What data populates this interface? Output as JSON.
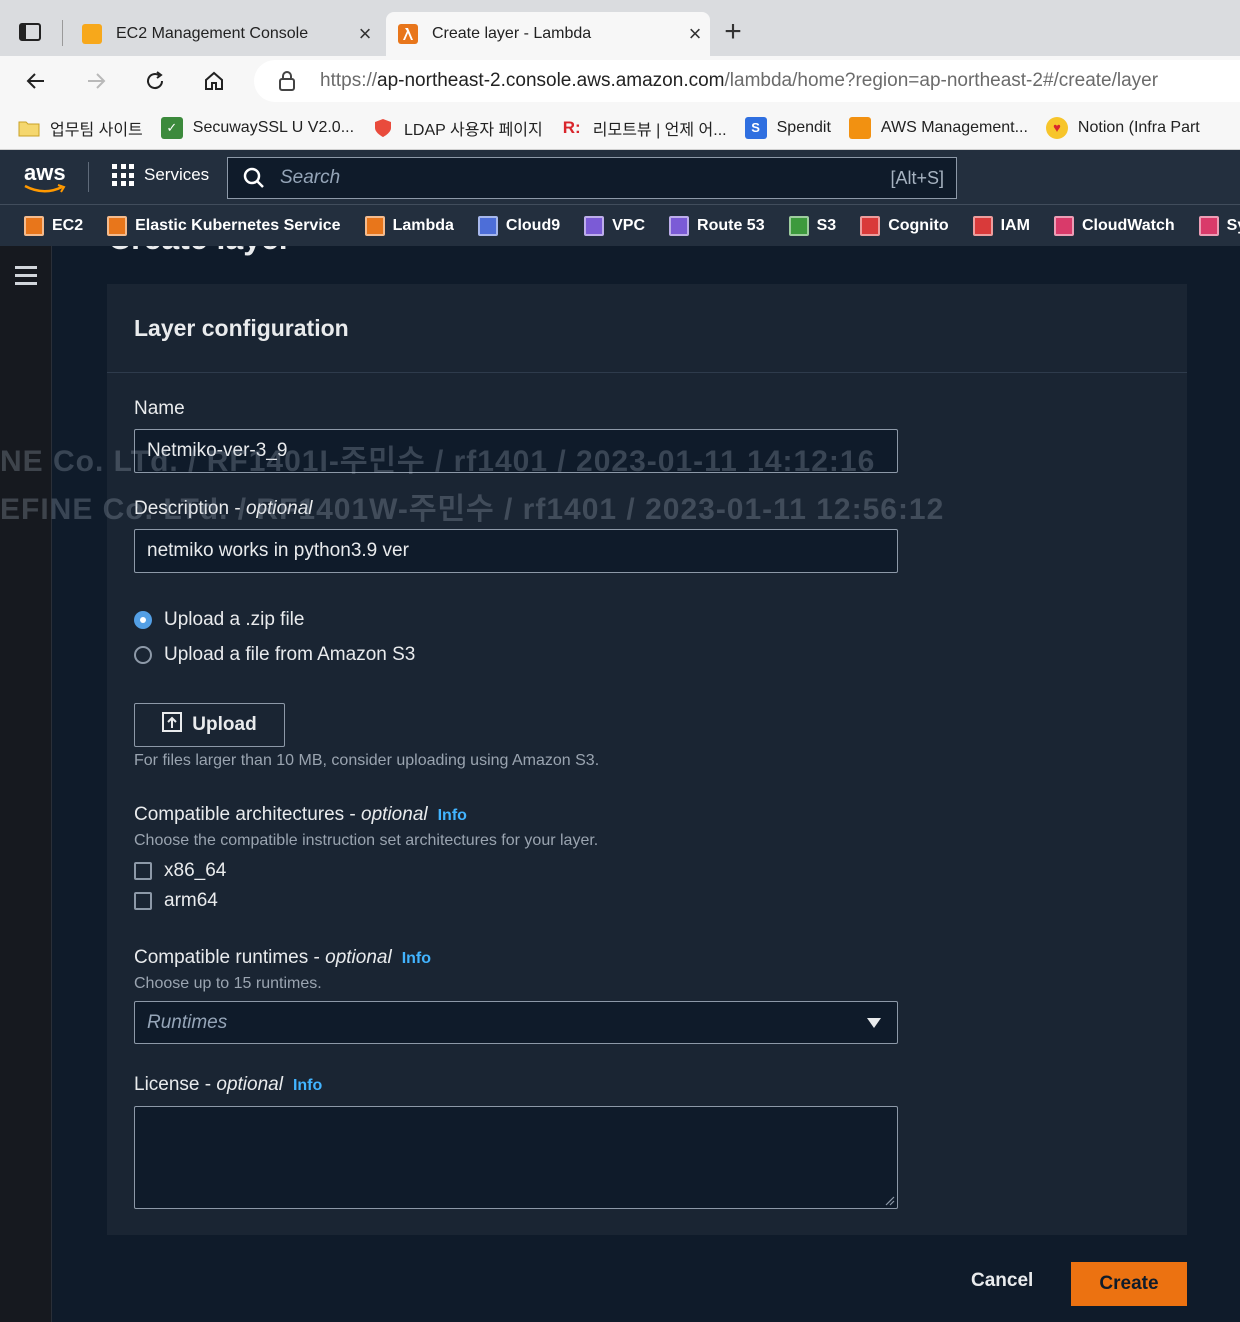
{
  "browser": {
    "tabs": [
      {
        "title": "EC2 Management Console",
        "active": false,
        "icon": "ec2-favicon"
      },
      {
        "title": "Create layer - Lambda",
        "active": true,
        "icon": "lambda-favicon"
      }
    ],
    "url_scheme": "https://",
    "url_host": "ap-northeast-2.console.aws.amazon.com",
    "url_path": "/lambda/home?region=ap-northeast-2#/create/layer",
    "bookmarks": [
      {
        "label": "업무팀 사이트",
        "icon": "folder-icon"
      },
      {
        "label": "SecuwaySSL U V2.0...",
        "icon": "globe-network-icon"
      },
      {
        "label": "LDAP 사용자 페이지",
        "icon": "shield-icon"
      },
      {
        "label": "리모트뷰 | 언제 어...",
        "icon": "rv-logo-icon"
      },
      {
        "label": "Spendit",
        "icon": "spendit-icon"
      },
      {
        "label": "AWS Management...",
        "icon": "aws-cube-icon"
      },
      {
        "label": "Notion (Infra Part",
        "icon": "emoji-heart-eyes-icon"
      }
    ]
  },
  "aws_header": {
    "logo": "aws",
    "services_label": "Services",
    "search_placeholder": "Search",
    "search_shortcut": "[Alt+S]",
    "favorites": [
      "EC2",
      "Elastic Kubernetes Service",
      "Lambda",
      "Cloud9",
      "VPC",
      "Route 53",
      "S3",
      "Cognito",
      "IAM",
      "CloudWatch",
      "Syste"
    ]
  },
  "page": {
    "heading": "Create layer",
    "panel_title": "Layer configuration",
    "name_label": "Name",
    "name_value": "Netmiko-ver-3_9",
    "description_label": "Description",
    "optional_suffix": "optional",
    "description_value": "netmiko works in python3.9 ver",
    "radio_zip": "Upload a .zip file",
    "radio_s3": "Upload a file from Amazon S3",
    "upload_button": "Upload",
    "upload_hint": "For files larger than 10 MB, consider uploading using Amazon S3.",
    "arch_label": "Compatible architectures",
    "arch_hint": "Choose the compatible instruction set architectures for your layer.",
    "arch_options": [
      "x86_64",
      "arm64"
    ],
    "runtimes_label": "Compatible runtimes",
    "runtimes_hint": "Choose up to 15 runtimes.",
    "runtimes_placeholder": "Runtimes",
    "license_label": "License",
    "info_link": "Info",
    "cancel_button": "Cancel",
    "create_button": "Create"
  },
  "watermark": {
    "line1": "NE Co. LTd. / RF1401I-주민수 / rf1401 / 2023-01-11 14:12:16",
    "line2": "EFINE Co. LTd. / RF1401W-주민수 / rf1401 / 2023-01-11 12:56:12"
  },
  "colors": {
    "aws_nav": "#232f3e",
    "page_bg": "#0f1b2a",
    "panel_bg": "#1a2533",
    "accent_orange": "#ec7211",
    "link_blue": "#42b4ff"
  }
}
